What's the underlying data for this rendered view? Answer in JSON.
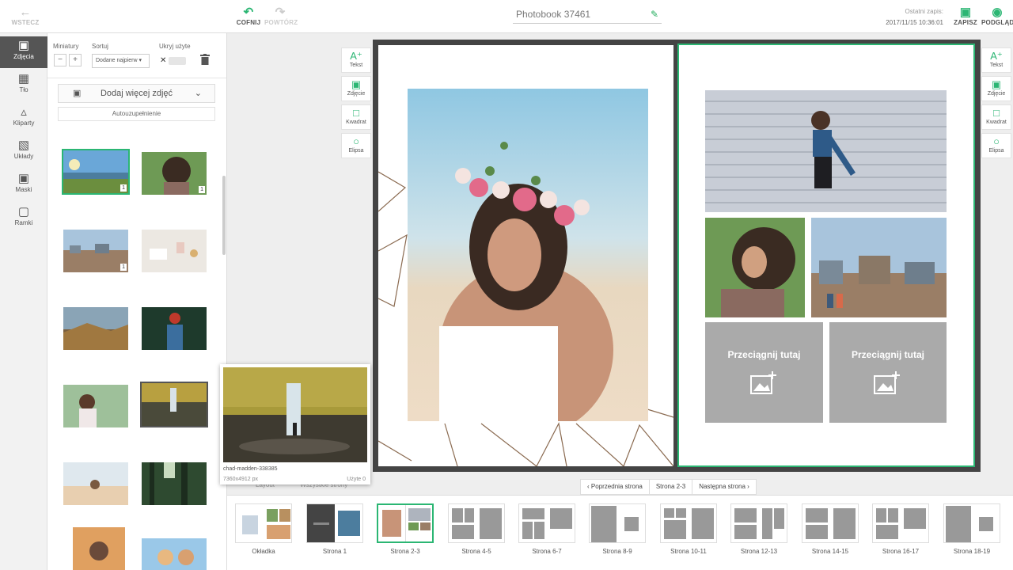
{
  "topbar": {
    "back_label": "WSTECZ",
    "undo_label": "COFNIJ",
    "redo_label": "POWTÓRZ",
    "project_title": "Photobook 37461",
    "last_save_label": "Ostatni zapis:",
    "last_save_time": "2017/11/15 10:36:01",
    "save_label": "ZAPISZ",
    "preview_label": "PODGLĄD"
  },
  "nav": {
    "items": [
      {
        "label": "Zdjęcia",
        "icon": "photo-icon"
      },
      {
        "label": "Tło",
        "icon": "background-icon"
      },
      {
        "label": "Kliparty",
        "icon": "clipart-icon"
      },
      {
        "label": "Układy",
        "icon": "layout-icon"
      },
      {
        "label": "Maski",
        "icon": "mask-icon"
      },
      {
        "label": "Ramki",
        "icon": "frame-icon"
      }
    ]
  },
  "panel": {
    "thumbs_label": "Miniatury",
    "sort_label": "Sortuj",
    "sort_value": "Dodane najpierw",
    "hide_used_label": "Ukryj użyte",
    "add_more_label": "Dodaj więcej zdjęć",
    "autofill_label": "Autouzupełnienie",
    "photo_counts": [
      "1",
      "1",
      "1"
    ]
  },
  "preview": {
    "filename": "chad-madden-338385",
    "dimensions": "7360x4912 px",
    "used": "Użyte 0"
  },
  "tools": [
    {
      "label": "Tekst",
      "icon": "text-add-icon"
    },
    {
      "label": "Zdjęcie",
      "icon": "image-add-icon"
    },
    {
      "label": "Kwadrat",
      "icon": "square-icon"
    },
    {
      "label": "Elipsa",
      "icon": "ellipse-icon"
    }
  ],
  "canvas": {
    "drop_label": "Przeciągnij tutaj"
  },
  "pagination": {
    "prev": "Poprzednia strona",
    "current": "Strona 2-3",
    "next": "Następna strona"
  },
  "bottom_tabs": [
    "Layout",
    "Wszystkie strony"
  ],
  "pages": [
    "Okładka",
    "Strona 1",
    "Strona 2-3",
    "Strona 4-5",
    "Strona 6-7",
    "Strona 8-9",
    "Strona 10-11",
    "Strona 12-13",
    "Strona 14-15",
    "Strona 16-17",
    "Strona 18-19"
  ],
  "colors": {
    "accent": "#2bb673",
    "nav_active": "#555555",
    "placeholder": "#aaaaaa"
  }
}
